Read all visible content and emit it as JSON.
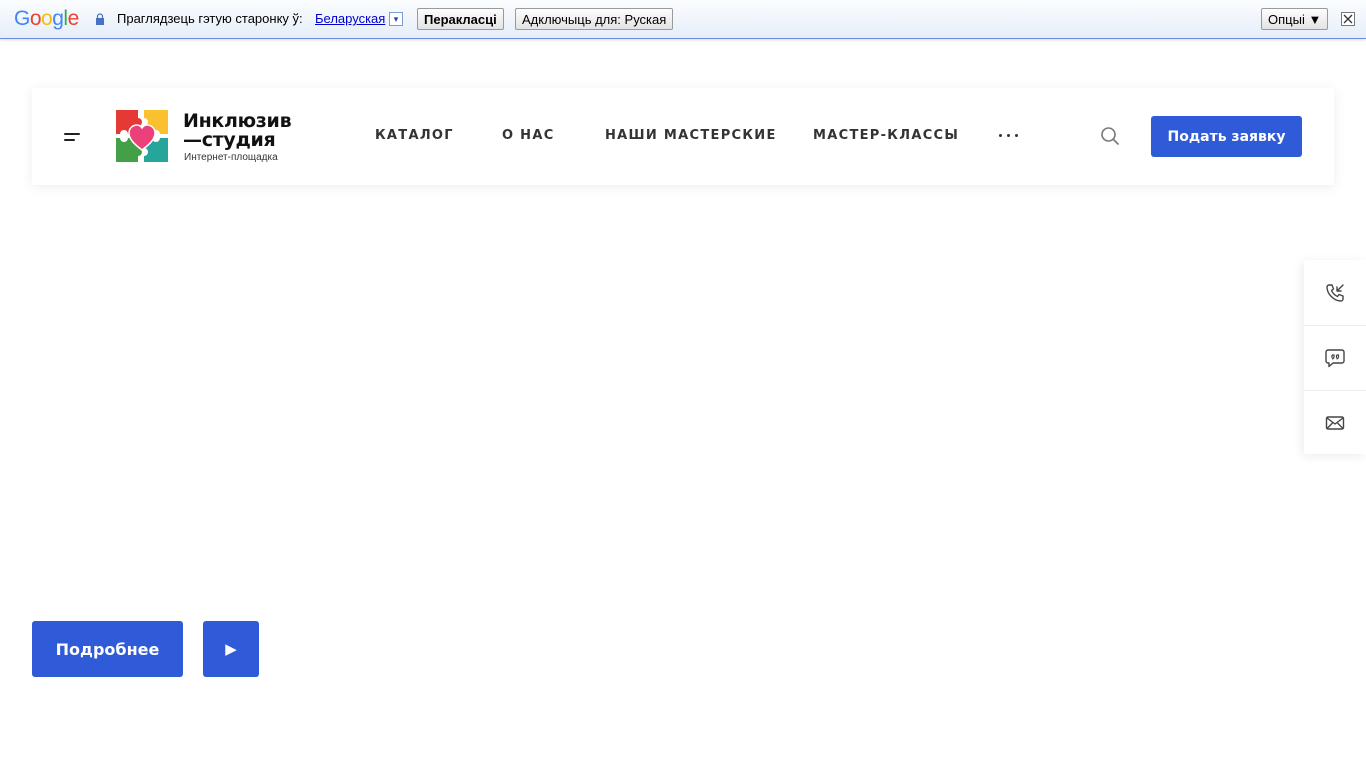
{
  "translate_bar": {
    "logo_text": "Google",
    "prompt": "Праглядзець гэтую старонку ў:",
    "language": "Беларуская",
    "language_arrow": "▾",
    "translate_button": "Перакласці",
    "disable_button": "Адключыць для: Руская",
    "options_button": "Опцыі ▼",
    "close_icon": "close-icon"
  },
  "header": {
    "logo": {
      "title_line1": "Инклюзив",
      "title_line2": "—студия",
      "subtitle": "Интернет-площадка",
      "colors": [
        "#e53935",
        "#fbc02d",
        "#43a047",
        "#26a69a",
        "#ec407a"
      ]
    },
    "nav": {
      "catalog": "КАТАЛОГ",
      "about": "О НАС",
      "workshops": "НАШИ МАСТЕРСКИЕ",
      "master_classes": "МАСТЕР-КЛАССЫ",
      "more_icon": "ellipsis-icon"
    },
    "search_icon": "search-icon",
    "apply_button": "Подать заявку"
  },
  "side_panel": {
    "items": [
      {
        "icon": "phone-callback-icon"
      },
      {
        "icon": "chat-quote-icon"
      },
      {
        "icon": "mail-icon"
      }
    ]
  },
  "hero": {
    "more_button": "Подробнее",
    "play_button": "▶"
  },
  "colors": {
    "accent": "#2f5bd8",
    "text": "#333333",
    "background": "#ffffff"
  }
}
